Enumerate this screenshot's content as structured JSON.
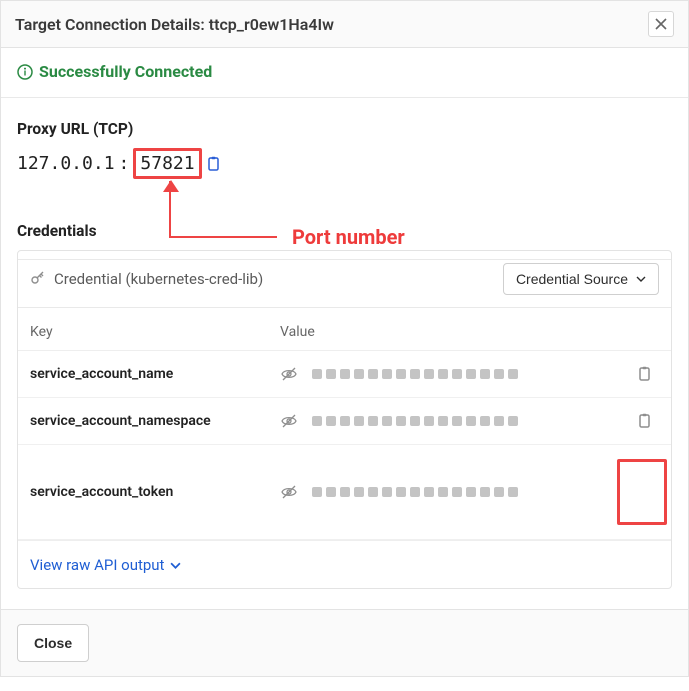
{
  "header": {
    "title": "Target Connection Details: ttcp_r0ew1Ha4Iw"
  },
  "status": {
    "text": "Successfully Connected"
  },
  "proxy": {
    "section_title": "Proxy URL (TCP)",
    "host": "127.0.0.1",
    "sep": ":",
    "port": "57821"
  },
  "annotation": {
    "port_label": "Port number"
  },
  "credentials": {
    "section_title": "Credentials",
    "credential_label": "Credential (kubernetes-cred-lib)",
    "source_btn": "Credential Source",
    "key_header": "Key",
    "value_header": "Value",
    "rows": {
      "r0": {
        "key": "service_account_name"
      },
      "r1": {
        "key": "service_account_namespace"
      },
      "r2": {
        "key": "service_account_token"
      }
    },
    "raw_link": "View raw API output"
  },
  "footer": {
    "close_label": "Close"
  }
}
